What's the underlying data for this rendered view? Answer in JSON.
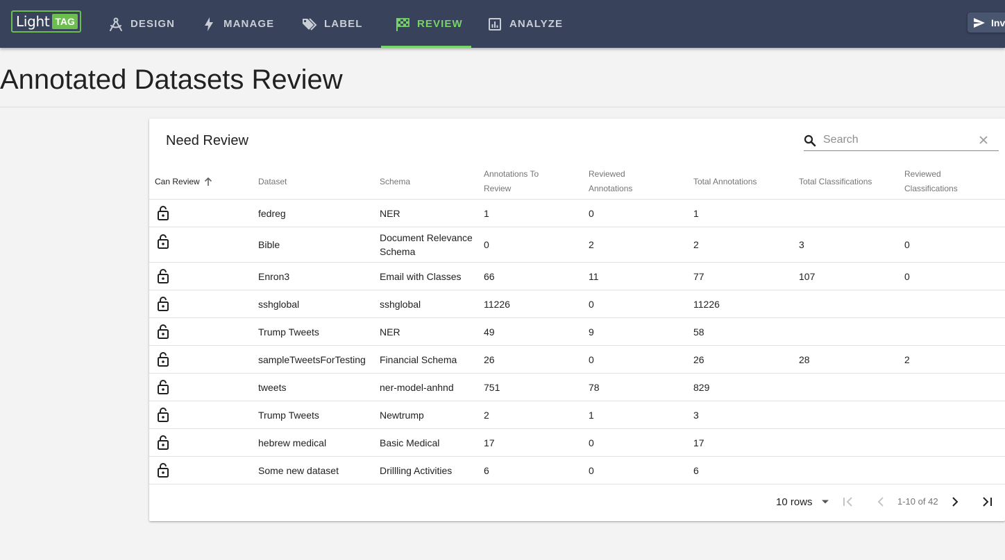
{
  "app": {
    "logo_text": "Light",
    "logo_badge": "TAG"
  },
  "nav": [
    {
      "label": "Design",
      "icon": "compass-icon"
    },
    {
      "label": "Manage",
      "icon": "bolt-icon"
    },
    {
      "label": "Label",
      "icon": "tags-icon"
    },
    {
      "label": "Review",
      "icon": "checkered-flag-icon",
      "active": true
    },
    {
      "label": "Analyze",
      "icon": "bar-chart-icon"
    }
  ],
  "invite_label": "Inv",
  "page_title": "Annotated Datasets Review",
  "card": {
    "title": "Need Review",
    "search_placeholder": "Search"
  },
  "table": {
    "headers": {
      "can_review": "Can Review",
      "dataset": "Dataset",
      "schema": "Schema",
      "to_review_1": "Annotations To",
      "to_review_2": "Review",
      "reviewed_ann_1": "Reviewed",
      "reviewed_ann_2": "Annotations",
      "total_ann": "Total Annotations",
      "total_cls": "Total Classifications",
      "reviewed_cls_1": "Reviewed",
      "reviewed_cls_2": "Classifications"
    },
    "rows": [
      {
        "dataset": "fedreg",
        "schema": "NER",
        "to_review": "1",
        "reviewed": "0",
        "total": "1",
        "total_cls": "",
        "reviewed_cls": ""
      },
      {
        "dataset": "Bible",
        "schema": "Document Relevance Schema",
        "to_review": "0",
        "reviewed": "2",
        "total": "2",
        "total_cls": "3",
        "reviewed_cls": "0"
      },
      {
        "dataset": "Enron3",
        "schema": "Email with Classes",
        "to_review": "66",
        "reviewed": "11",
        "total": "77",
        "total_cls": "107",
        "reviewed_cls": "0"
      },
      {
        "dataset": "sshglobal",
        "schema": "sshglobal",
        "to_review": "11226",
        "reviewed": "0",
        "total": "11226",
        "total_cls": "",
        "reviewed_cls": ""
      },
      {
        "dataset": "Trump Tweets",
        "schema": "NER",
        "to_review": "49",
        "reviewed": "9",
        "total": "58",
        "total_cls": "",
        "reviewed_cls": ""
      },
      {
        "dataset": "sampleTweetsForTesting",
        "schema": "Financial Schema",
        "to_review": "26",
        "reviewed": "0",
        "total": "26",
        "total_cls": "28",
        "reviewed_cls": "2"
      },
      {
        "dataset": "tweets",
        "schema": "ner-model-anhnd",
        "to_review": "751",
        "reviewed": "78",
        "total": "829",
        "total_cls": "",
        "reviewed_cls": ""
      },
      {
        "dataset": "Trump Tweets",
        "schema": "Newtrump",
        "to_review": "2",
        "reviewed": "1",
        "total": "3",
        "total_cls": "",
        "reviewed_cls": ""
      },
      {
        "dataset": "hebrew medical",
        "schema": "Basic Medical",
        "to_review": "17",
        "reviewed": "0",
        "total": "17",
        "total_cls": "",
        "reviewed_cls": ""
      },
      {
        "dataset": "Some new dataset",
        "schema": "Drillling Activities",
        "to_review": "6",
        "reviewed": "0",
        "total": "6",
        "total_cls": "",
        "reviewed_cls": ""
      }
    ]
  },
  "pagination": {
    "rows_label": "10 rows",
    "range": "1-10 of 42"
  },
  "colors": {
    "topbar": "#38425a",
    "accent": "#77d36a",
    "nav_text": "#c9cdd6"
  }
}
